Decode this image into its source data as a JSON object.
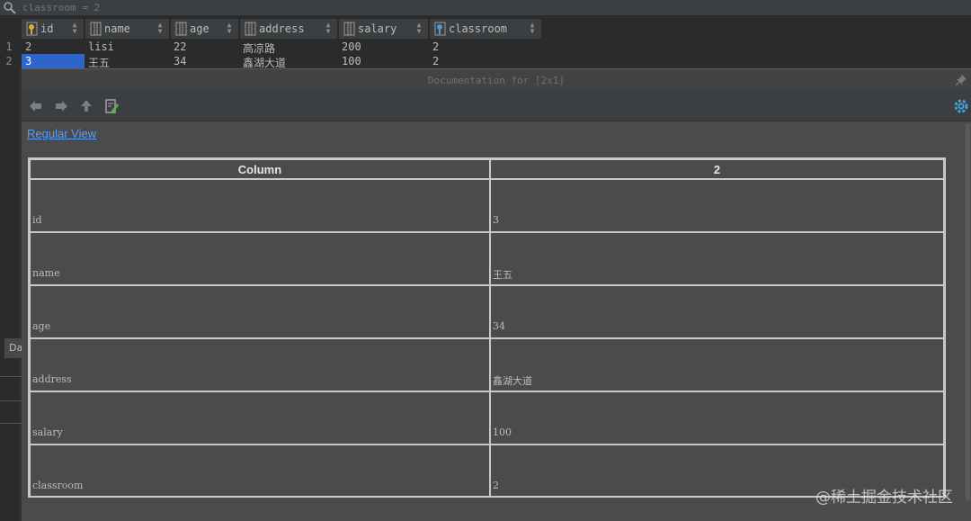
{
  "filter": {
    "text": "classroom = 2"
  },
  "grid": {
    "columns": [
      {
        "label": "id",
        "icon": "primary-key-icon"
      },
      {
        "label": "name",
        "icon": "column-icon"
      },
      {
        "label": "age",
        "icon": "column-icon"
      },
      {
        "label": "address",
        "icon": "column-icon"
      },
      {
        "label": "salary",
        "icon": "column-icon"
      },
      {
        "label": "classroom",
        "icon": "foreign-key-icon"
      }
    ],
    "rows": [
      {
        "num": "1",
        "cells": [
          "2",
          "lisi",
          "22",
          "高凉路",
          "200",
          "2"
        ]
      },
      {
        "num": "2",
        "cells": [
          "3",
          "王五",
          "34",
          "鑫湖大道",
          "100",
          "2"
        ]
      }
    ]
  },
  "side_tab": {
    "label": "Da"
  },
  "doc": {
    "title": "Documentation for [2x1]",
    "link": "Regular View",
    "table": {
      "headers": [
        "Column",
        "2"
      ],
      "rows": [
        {
          "column": "id",
          "value": "3"
        },
        {
          "column": "name",
          "value": "王五"
        },
        {
          "column": "age",
          "value": "34"
        },
        {
          "column": "address",
          "value": "鑫湖大道"
        },
        {
          "column": "salary",
          "value": "100"
        },
        {
          "column": "classroom",
          "value": "2"
        }
      ]
    }
  },
  "watermark": "@稀土掘金技术社区",
  "colors": {
    "selection": "#2f65ca",
    "link": "#589df6",
    "key_icon": "#e0a93a",
    "fk_icon": "#4a9fd8"
  }
}
